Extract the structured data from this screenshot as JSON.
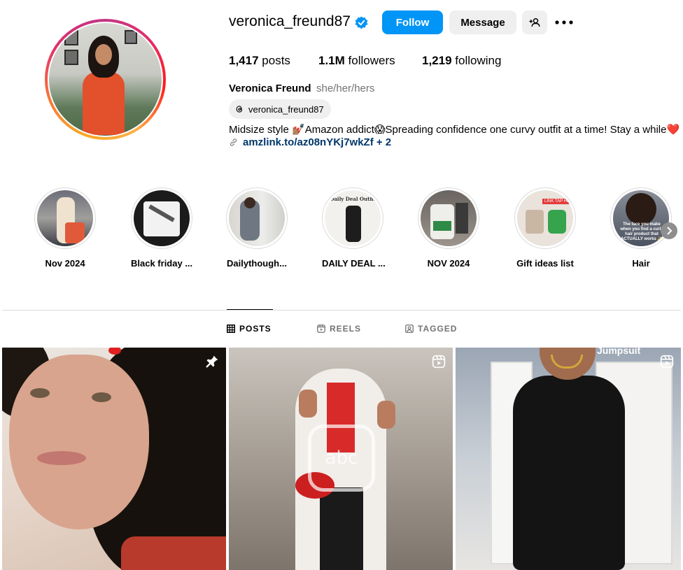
{
  "profile": {
    "username": "veronica_freund87",
    "full_name": "Veronica Freund",
    "pronouns": "she/her/hers",
    "threads_handle": "veronica_freund87",
    "bio": "Midsize style 💅🏽Amazon addict😱Spreading confidence one curvy outfit at a time! Stay a while❤️",
    "link": "amzlink.to/az08nYKj7wkZf + 2"
  },
  "buttons": {
    "follow": "Follow",
    "message": "Message"
  },
  "stats": {
    "posts_count": "1,417",
    "posts_label": "posts",
    "followers_count": "1.1M",
    "followers_label": "followers",
    "following_count": "1,219",
    "following_label": "following"
  },
  "highlights": [
    {
      "label": "Nov 2024"
    },
    {
      "label": "Black friday ..."
    },
    {
      "label": "Dailythough..."
    },
    {
      "label": "DAILY DEAL ..."
    },
    {
      "label": "NOV 2024"
    },
    {
      "label": "Gift ideas list"
    },
    {
      "label": "Hair"
    }
  ],
  "highlight_texts": {
    "daily_deal": "Daily Deal Outfit",
    "hair": "The face you make when you find a curly hair product that ACTUALLY works ✨",
    "gift": "LINK TAP HERE"
  },
  "tabs": [
    {
      "label": "POSTS",
      "active": true
    },
    {
      "label": "REELS",
      "active": false
    },
    {
      "label": "TAGGED",
      "active": false
    }
  ],
  "posts": [
    {
      "badge": "pin-icon"
    },
    {
      "badge": "reel-icon",
      "overlay_text": "abc"
    },
    {
      "badge": "reel-icon",
      "caption": "Jumpsuit"
    }
  ],
  "colors": {
    "accent": "#0095f6",
    "link": "#00376b",
    "secondary_text": "#737373",
    "button_bg": "#efefef"
  }
}
